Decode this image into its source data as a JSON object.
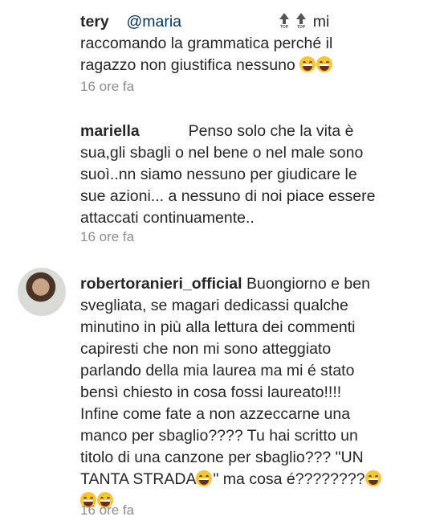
{
  "comments": [
    {
      "username": "tery",
      "mention": "@maria",
      "icon1": "top-arrow-icon",
      "icon2": "top-arrow-icon",
      "line1_end": "mi",
      "line2": "raccomando la grammatica perché il",
      "line3": "ragazzo non giustifica nessuno",
      "emoji": "grinning-sweat-emoji",
      "time": "16 ore fa"
    },
    {
      "username": "mariella",
      "l1": "Penso solo che la vita è",
      "l2": "sua,gli sbagli  o nel bene o nel male sono",
      "l3": "suoì..nn siamo nessuno per giudicare  le",
      "l4": "sue azioni... a nessuno di noi piace essere",
      "l5": "attaccati continuamente..",
      "time": "16 ore fa"
    },
    {
      "username": "robertoranieri_official",
      "l1": "Buongiorno e ben",
      "l2": "svegliata, se magari dedicassi qualche",
      "l3": "minutino in più alla lettura dei commenti",
      "l4": "capiresti che non mi sono atteggiato",
      "l5": "parlando della mia laurea ma mi é stato",
      "l6": "bensì chiesto in cosa fossi laureato!!!!",
      "l7": "Infine come fate a non azzeccarne una",
      "l8": "manco per sbaglio???? Tu hai scritto un",
      "l9": "titolo di una canzone per sbaglio??? \"UN",
      "l10a": "TANTA STRADA",
      "l10b": "\" ma cosa é????????",
      "time": "16 ore fa"
    }
  ]
}
